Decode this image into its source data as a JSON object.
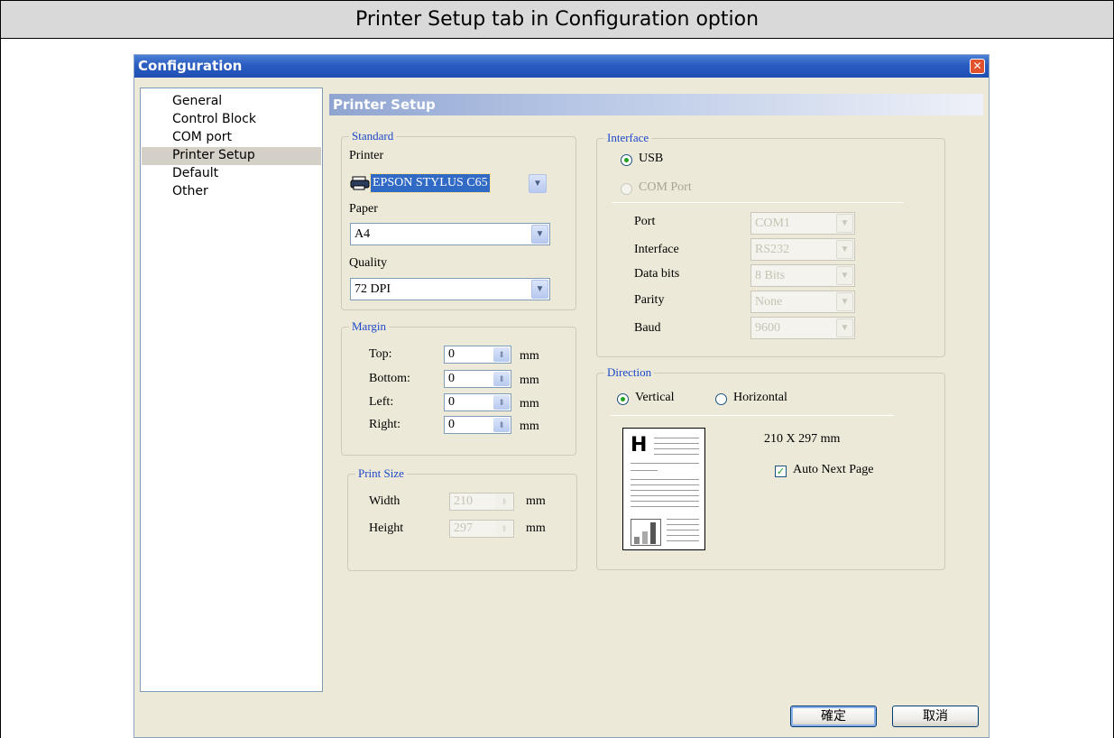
{
  "caption": "Printer Setup tab in Configuration option",
  "window": {
    "title": "Configuration",
    "close_glyph": "✕"
  },
  "nav": {
    "items": [
      "General",
      "Control Block",
      "COM port",
      "Printer Setup",
      "Default",
      "Other"
    ],
    "selected": "Printer Setup"
  },
  "panel_title": "Printer Setup",
  "standard": {
    "legend": "Standard",
    "printer_label": "Printer",
    "printer_value": "EPSON STYLUS C65",
    "paper_label": "Paper",
    "paper_value": "A4",
    "quality_label": "Quality",
    "quality_value": "72 DPI"
  },
  "margin": {
    "legend": "Margin",
    "rows": [
      {
        "label": "Top:",
        "value": "0",
        "unit": "mm"
      },
      {
        "label": "Bottom:",
        "value": "0",
        "unit": "mm"
      },
      {
        "label": "Left:",
        "value": "0",
        "unit": "mm"
      },
      {
        "label": "Right:",
        "value": "0",
        "unit": "mm"
      }
    ]
  },
  "print_size": {
    "legend": "Print Size",
    "rows": [
      {
        "label": "Width",
        "value": "210",
        "unit": "mm"
      },
      {
        "label": "Height",
        "value": "297",
        "unit": "mm"
      }
    ]
  },
  "interface": {
    "legend": "Interface",
    "usb_label": "USB",
    "usb_selected": true,
    "com_label": "COM Port",
    "com_enabled": false,
    "fields": [
      {
        "label": "Port",
        "value": "COM1"
      },
      {
        "label": "Interface",
        "value": "RS232"
      },
      {
        "label": "Data bits",
        "value": "8 Bits"
      },
      {
        "label": "Parity",
        "value": "None"
      },
      {
        "label": "Baud",
        "value": "9600"
      }
    ]
  },
  "direction": {
    "legend": "Direction",
    "vertical_label": "Vertical",
    "horizontal_label": "Horizontal",
    "selected": "Vertical",
    "page_size_text": "210 X 297 mm",
    "auto_next_label": "Auto Next Page",
    "auto_next_checked": true,
    "preview_letter": "H"
  },
  "buttons": {
    "ok": "確定",
    "cancel": "取消"
  },
  "icons": {
    "printer": "printer-icon",
    "dropdown": "chevron-down-icon",
    "spinner": "spin-arrows-icon",
    "close": "close-icon"
  },
  "colors": {
    "titlebar": "#2a5cc0",
    "legend_text": "#1d48c8",
    "dialog_bg": "#ece9d8",
    "selection": "#316ac5"
  }
}
